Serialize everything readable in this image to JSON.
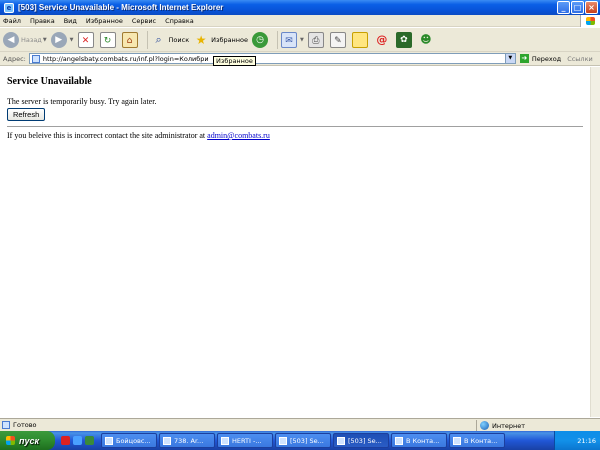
{
  "window": {
    "title": "[503] Service Unavailable - Microsoft Internet Explorer"
  },
  "menu": [
    "Файл",
    "Правка",
    "Вид",
    "Избранное",
    "Сервис",
    "Справка"
  ],
  "toolbar": {
    "back_label": "Назад",
    "search_label": "Поиск",
    "favorites_label": "Избранное",
    "tooltip": "Избранное"
  },
  "address": {
    "label": "Адрес:",
    "url": "http://angelsbaty.combats.ru/inf.pl?login=Колибри",
    "go_label": "Переход",
    "links_label": "Ссылки"
  },
  "page": {
    "heading": "Service Unavailable",
    "message": "The server is temporarily busy. Try again later.",
    "refresh_label": "Refresh",
    "contact_text": "If you beleive this is incorrect contact the site administrator at ",
    "contact_email": "admin@combats.ru"
  },
  "status": {
    "text": "Готово",
    "zone": "Интернет"
  },
  "taskbar": {
    "start_label": "пуск",
    "tasks": [
      "Бойцовс...",
      "738. Ar...",
      "HERTI -...",
      "[503] Se...",
      "[503] Se...",
      "В Конта...",
      "В Конта..."
    ],
    "active_index": 4,
    "clock": "21:16"
  }
}
